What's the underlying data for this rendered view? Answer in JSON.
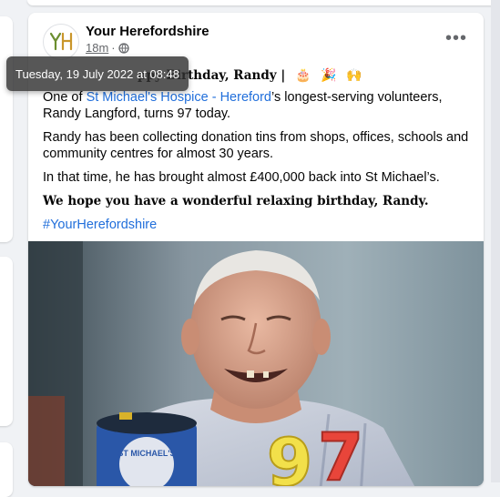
{
  "page": {
    "name": "Your Herefordshire",
    "logo_letters": "YH",
    "time": "18m",
    "tooltip": "Tuesday, 19 July 2022 at 08:48"
  },
  "post": {
    "greeting_partial": "ppy Birthday, Randy |",
    "greeting_emoji": [
      "🎂",
      "🎉",
      "🙌"
    ],
    "line1_prefix": "One of ",
    "line1_link": "St Michael's Hospice - Hereford",
    "line1_suffix": "’s longest-serving volunteers, Randy Langford, turns 97 today.",
    "para2": "Randy has been collecting donation tins from shops, offices, schools and community centres for almost 30 years.",
    "para3": "In that time, he has brought almost £400,000 back into St Michael’s.",
    "para4": "We hope you have a wonderful relaxing birthday, Randy.",
    "hashtag": "#YourHerefordshire"
  },
  "photo": {
    "tin_text": "ST MICHAEL'S",
    "candles": "97"
  },
  "colors": {
    "link": "#216fdb",
    "muted": "#65676b",
    "background": "#f0f2f5"
  },
  "icons": {
    "globe": "globe-icon",
    "more": "more-options-icon"
  }
}
